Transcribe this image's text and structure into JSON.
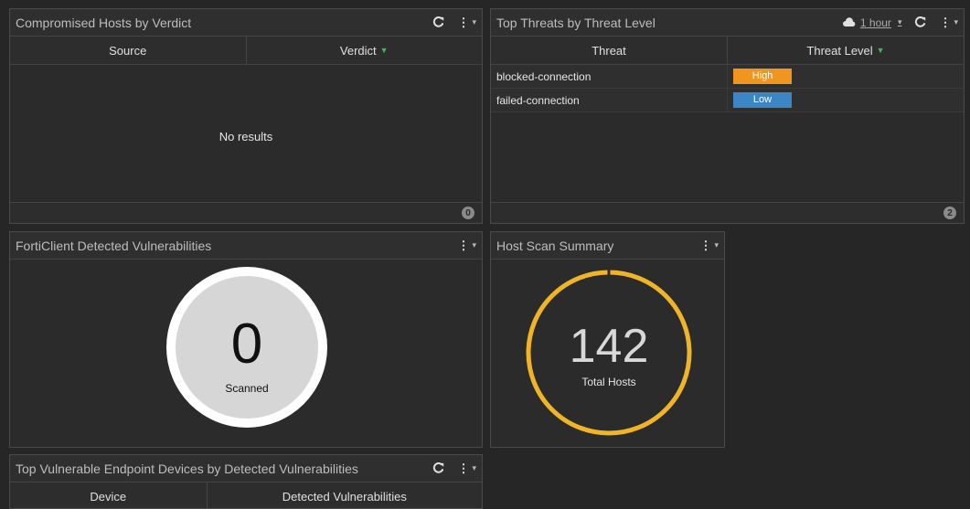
{
  "widgets": {
    "compromised": {
      "title": "Compromised Hosts by Verdict",
      "columns": [
        "Source",
        "Verdict"
      ],
      "empty_text": "No results",
      "count": "0"
    },
    "threats": {
      "title": "Top Threats by Threat Level",
      "time_range": "1 hour",
      "columns": [
        "Threat",
        "Threat Level"
      ],
      "rows": [
        {
          "threat": "blocked-connection",
          "level": "High",
          "color": "#f0961e"
        },
        {
          "threat": "failed-connection",
          "level": "Low",
          "color": "#3d86c6"
        }
      ],
      "count": "2"
    },
    "forticlient": {
      "title": "FortiClient Detected Vulnerabilities",
      "value": "0",
      "label": "Scanned"
    },
    "hostscan": {
      "title": "Host Scan Summary",
      "value": "142",
      "label": "Total Hosts",
      "ring_color": "#f0b429"
    },
    "topvuln": {
      "title": "Top Vulnerable Endpoint Devices by Detected Vulnerabilities",
      "columns": [
        "Device",
        "Detected Vulnerabilities"
      ]
    }
  },
  "icons": [
    "refresh-icon",
    "menu-icon",
    "cloud-icon",
    "sort-caret-icon"
  ]
}
